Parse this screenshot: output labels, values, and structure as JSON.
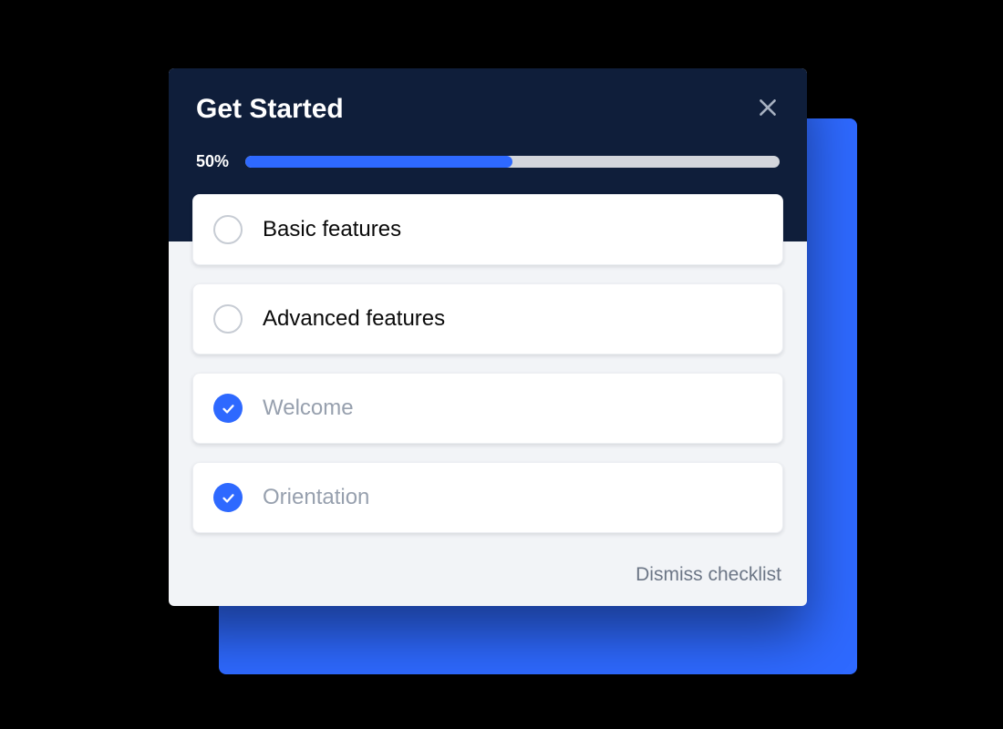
{
  "header": {
    "title": "Get Started"
  },
  "progress": {
    "percent": 50,
    "label": "50%"
  },
  "items": [
    {
      "label": "Basic features",
      "done": false
    },
    {
      "label": "Advanced features",
      "done": false
    },
    {
      "label": "Welcome",
      "done": true
    },
    {
      "label": "Orientation",
      "done": true
    }
  ],
  "footer": {
    "dismiss_label": "Dismiss checklist"
  },
  "colors": {
    "accent": "#2E69FF",
    "header_bg": "#0F1E3A"
  }
}
